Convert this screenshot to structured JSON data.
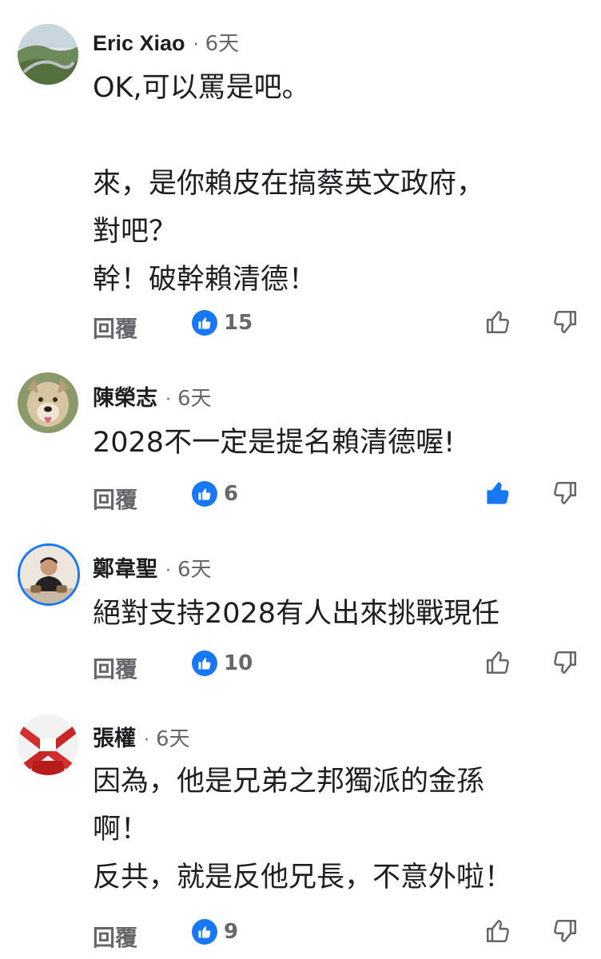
{
  "reply_label": "回覆",
  "time_separator": "·",
  "colors": {
    "accent": "#1877f2",
    "meta_text": "#65676b",
    "body_text": "#1c1e21"
  },
  "comments": [
    {
      "author": "Eric Xiao",
      "time": "6天",
      "lines": [
        "OK,可以罵是吧。",
        "",
        "來，是你賴皮在搞蔡英文政府，",
        "對吧？",
        "幹！破幹賴清德！"
      ],
      "like_count": "15",
      "upvoted": false
    },
    {
      "author": "陳榮志",
      "time": "6天",
      "lines": [
        "2028不一定是提名賴清德喔!"
      ],
      "like_count": "6",
      "upvoted": true
    },
    {
      "author": "鄭韋聖",
      "time": "6天",
      "lines": [
        "絕對支持2028有人出來挑戰現任"
      ],
      "like_count": "10",
      "upvoted": false
    },
    {
      "author": "張權",
      "time": "6天",
      "lines": [
        "因為，他是兄弟之邦獨派的金孫",
        "啊！",
        "反共，就是反他兄長，不意外啦！"
      ],
      "like_count": "9",
      "upvoted": false
    }
  ]
}
